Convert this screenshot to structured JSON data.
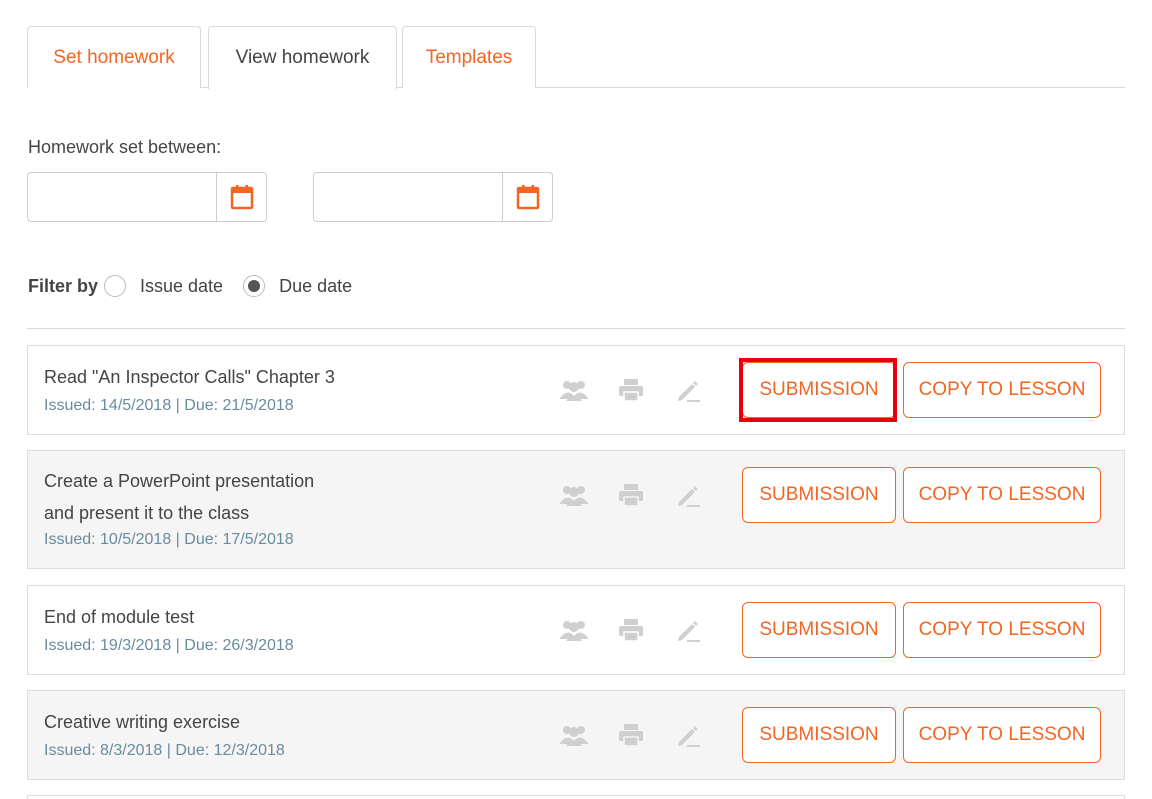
{
  "tabs": [
    {
      "label": "Set homework",
      "active": false
    },
    {
      "label": "View homework",
      "active": true
    },
    {
      "label": "Templates",
      "active": false
    }
  ],
  "filters": {
    "set_between_label": "Homework set between:",
    "date_from": {
      "value": "",
      "icon": "calendar-icon"
    },
    "date_to": {
      "value": "",
      "icon": "calendar-icon"
    },
    "filter_by_label": "Filter by",
    "options": [
      {
        "label": "Issue date",
        "selected": false
      },
      {
        "label": "Due date",
        "selected": true
      }
    ]
  },
  "homework": [
    {
      "title": "Read \"An Inspector Calls\" Chapter 3",
      "title_line2": "",
      "meta": "Issued: 14/5/2018 | Due: 21/5/2018"
    },
    {
      "title": "Create a PowerPoint presentation",
      "title_line2": "and present it to  the class",
      "meta": "Issued: 10/5/2018 | Due: 17/5/2018"
    },
    {
      "title": "End of module test",
      "title_line2": "",
      "meta": "Issued: 19/3/2018 | Due: 26/3/2018"
    },
    {
      "title": "Creative writing exercise",
      "title_line2": "",
      "meta": "Issued: 8/3/2018 | Due: 12/3/2018"
    }
  ],
  "buttons": {
    "submission": "SUBMISSION",
    "copy": "COPY TO LESSON"
  },
  "icons": [
    "group-icon",
    "print-icon",
    "edit-icon"
  ],
  "colors": {
    "accent": "#f26522",
    "highlight": "#e8000d",
    "meta_text": "#6a8a9e"
  }
}
